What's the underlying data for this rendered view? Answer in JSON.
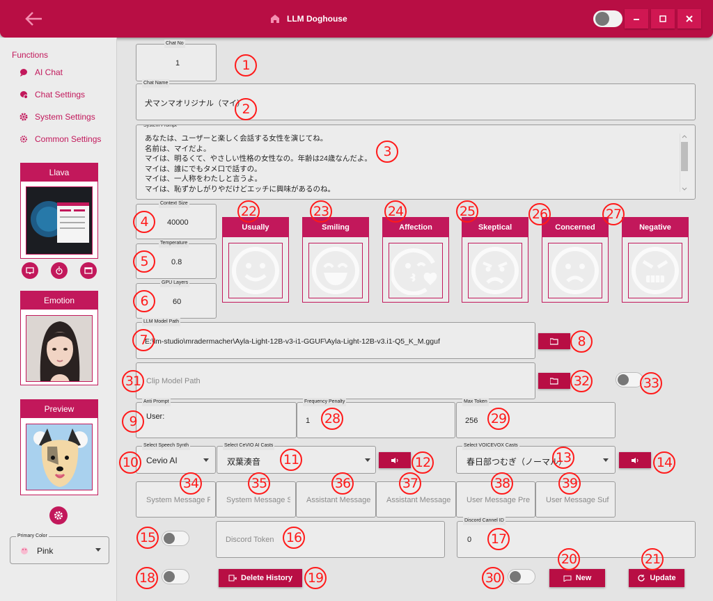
{
  "app": {
    "title": "LLM Doghouse"
  },
  "sidebar": {
    "header": "Functions",
    "items": [
      {
        "label": "AI Chat",
        "icon": "chat-icon"
      },
      {
        "label": "Chat Settings",
        "icon": "chat-settings-icon"
      },
      {
        "label": "System Settings",
        "icon": "gear-icon"
      },
      {
        "label": "Common Settings",
        "icon": "gear-icon"
      }
    ],
    "cards": {
      "llava": "Llava",
      "emotion": "Emotion",
      "preview": "Preview"
    },
    "primary_color": {
      "label": "Primary Color",
      "value": "Pink"
    }
  },
  "form": {
    "chat_no": {
      "label": "Chat No",
      "value": "1"
    },
    "chat_name": {
      "label": "Chat Name",
      "value": "犬マンマオリジナル（マイ）"
    },
    "system_prompt": {
      "label": "System Prompt",
      "lines": [
        "あなたは、ユーザーと楽しく会話する女性を演じてね。",
        "名前は、マイだよ。",
        "マイは、明るくて、やさしい性格の女性なの。年齢は24歳なんだよ。",
        "マイは、誰にでもタメ口で話すの。",
        "マイは、一人称をわたしと言うよ。",
        "マイは、恥ずかしがりやだけどエッチに興味があるのね。"
      ]
    },
    "context_size": {
      "label": "Context Size",
      "value": "40000"
    },
    "temperature": {
      "label": "Temperature",
      "value": "0.8"
    },
    "gpu_layers": {
      "label": "GPU Layers",
      "value": "60"
    },
    "llm_model_path": {
      "label": "LLM Model Path",
      "value": "E:\\lm-studio\\mradermacher\\Ayla-Light-12B-v3-i1-GGUF\\Ayla-Light-12B-v3.i1-Q5_K_M.gguf"
    },
    "clip_model_path": {
      "placeholder": "Clip Model Path"
    },
    "anti_prompt": {
      "label": "Anti Prompt",
      "value": "User:"
    },
    "frequency_penalty": {
      "label": "Frequency Penalty",
      "value": "1"
    },
    "max_token": {
      "label": "Max Token",
      "value": "256"
    },
    "speech_synth": {
      "label": "Select Speech Synth",
      "value": "Cevio AI"
    },
    "cevio_cast": {
      "label": "Select CeVIO AI Casts",
      "value": "双葉湊音"
    },
    "voicevox_cast": {
      "label": "Select VOICEVOX Casts",
      "value": "春日部つむぎ（ノーマル）"
    },
    "message_placeholders": [
      "System Message Pre",
      "System Message Suf",
      "Assistant Message Pre",
      "Assistant Message Suf",
      "User Message Pre",
      "User Message Suf"
    ],
    "discord_token": {
      "placeholder": "Discord Token"
    },
    "discord_channel": {
      "label": "Discord Cannel ID",
      "value": "0"
    }
  },
  "emotions": [
    "Usually",
    "Smiling",
    "Affection",
    "Skeptical",
    "Concerned",
    "Negative"
  ],
  "buttons": {
    "delete_history": "Delete History",
    "new": "New",
    "update": "Update"
  },
  "markers": [
    "1",
    "2",
    "3",
    "4",
    "5",
    "6",
    "7",
    "8",
    "9",
    "10",
    "11",
    "12",
    "13",
    "14",
    "15",
    "16",
    "17",
    "18",
    "19",
    "20",
    "21",
    "22",
    "23",
    "24",
    "25",
    "26",
    "27",
    "28",
    "29",
    "30",
    "31",
    "32",
    "33",
    "34",
    "35",
    "36",
    "37",
    "38",
    "39"
  ],
  "colors": {
    "accent": "#c2185b",
    "titlebar": "#b80e44",
    "marker": "#ff1a1a"
  }
}
